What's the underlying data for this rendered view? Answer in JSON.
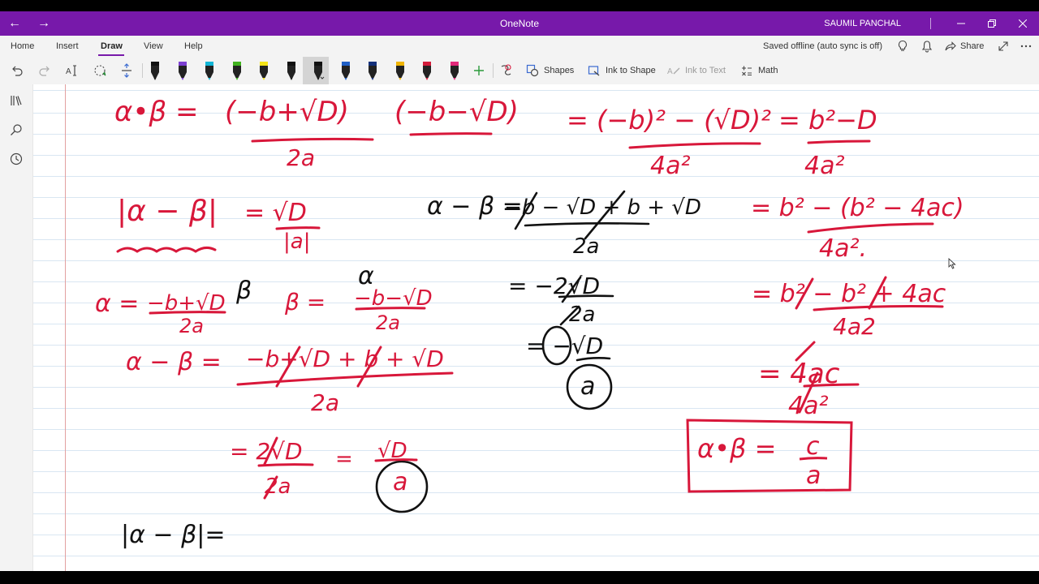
{
  "titlebar": {
    "app_title": "OneNote",
    "user_name": "SAUMIL PANCHAL",
    "back_icon": "arrow-left-icon",
    "forward_icon": "arrow-right-icon",
    "background_color": "#7719aa"
  },
  "menu": {
    "tabs": [
      {
        "label": "Home"
      },
      {
        "label": "Insert"
      },
      {
        "label": "Draw",
        "active": true
      },
      {
        "label": "View"
      },
      {
        "label": "Help"
      }
    ],
    "sync_status": "Saved offline (auto sync is off)",
    "share_label": "Share"
  },
  "toolbar": {
    "pens": [
      {
        "name": "black-pen",
        "color": "#111111"
      },
      {
        "name": "purple-pen",
        "color": "#7c3fd1"
      },
      {
        "name": "cyan-pen",
        "color": "#11b5d6"
      },
      {
        "name": "green-pen",
        "color": "#40b21e"
      },
      {
        "name": "yellow-highlighter",
        "color": "#f4e418"
      },
      {
        "name": "black-pen-2",
        "color": "#111111"
      },
      {
        "name": "black-pen-selected",
        "color": "#111111",
        "selected": true
      },
      {
        "name": "blue-pen",
        "color": "#1f5fc6"
      },
      {
        "name": "navy-pen",
        "color": "#14307a"
      },
      {
        "name": "gold-pen",
        "color": "#f0b400"
      },
      {
        "name": "red-pen",
        "color": "#d21b3a"
      },
      {
        "name": "pink-pen",
        "color": "#e3287a"
      }
    ],
    "shapes_label": "Shapes",
    "ink_to_shape_label": "Ink to Shape",
    "ink_to_text_label": "Ink to Text",
    "math_label": "Math"
  },
  "colors": {
    "accent": "#7719aa",
    "ink_red": "#d8173a",
    "ink_black": "#111111",
    "rule_line": "#d9e6f2",
    "margin_line": "#e3a0a0"
  },
  "ink": {
    "row1_lhs": "α•β =",
    "row1_num1": "(−b+√D)",
    "row1_num2": "(−b−√D)",
    "row1_den": "2a",
    "row1_mid_num": "= (−b)² − (√D)²",
    "row1_mid_den": "4a²",
    "row1_right_num": "= b²−D",
    "row1_right_den": "4a²",
    "row2_abs": "|α − β|",
    "row2_eq_num": "= √D",
    "row2_eq_den": "|a|",
    "row2_mid_lhs": "α − β =",
    "row2_mid_num": "−b − √D + b + √D",
    "row2_mid_den": "2a",
    "row2_right_num": "= b² − (b² − 4ac)",
    "row2_right_den": "4a².",
    "row3_alpha": "α =",
    "row3_alpha_num": "−b+√D",
    "row3_alpha_den": "2a",
    "row3_swap": "β",
    "row3_beta": "β =",
    "row3_beta_over": "α",
    "row3_beta_num": "−b−√D",
    "row3_beta_den": "2a",
    "row3_mid_num": "= −2√D",
    "row3_mid_den": "2a",
    "row3_right_num": "= b² − b² + 4ac",
    "row3_right_den": "4a2",
    "row4_lhs": "α − β =",
    "row4_num": "−b+√D + b + √D",
    "row4_den": "2a",
    "row4_mid_num": "= −√D",
    "row4_mid_den": "a",
    "row4_right_num": "= 4ac",
    "row4_right_den": "4a²",
    "box_lhs": "α•β =",
    "box_num": "c",
    "box_den": "a",
    "row5_num": "= 2√D",
    "row5_den": "2a",
    "row5_eq": "=",
    "row5_res_num": "√D",
    "row5_res_den": "a",
    "row6_abs": "|α − β|="
  }
}
